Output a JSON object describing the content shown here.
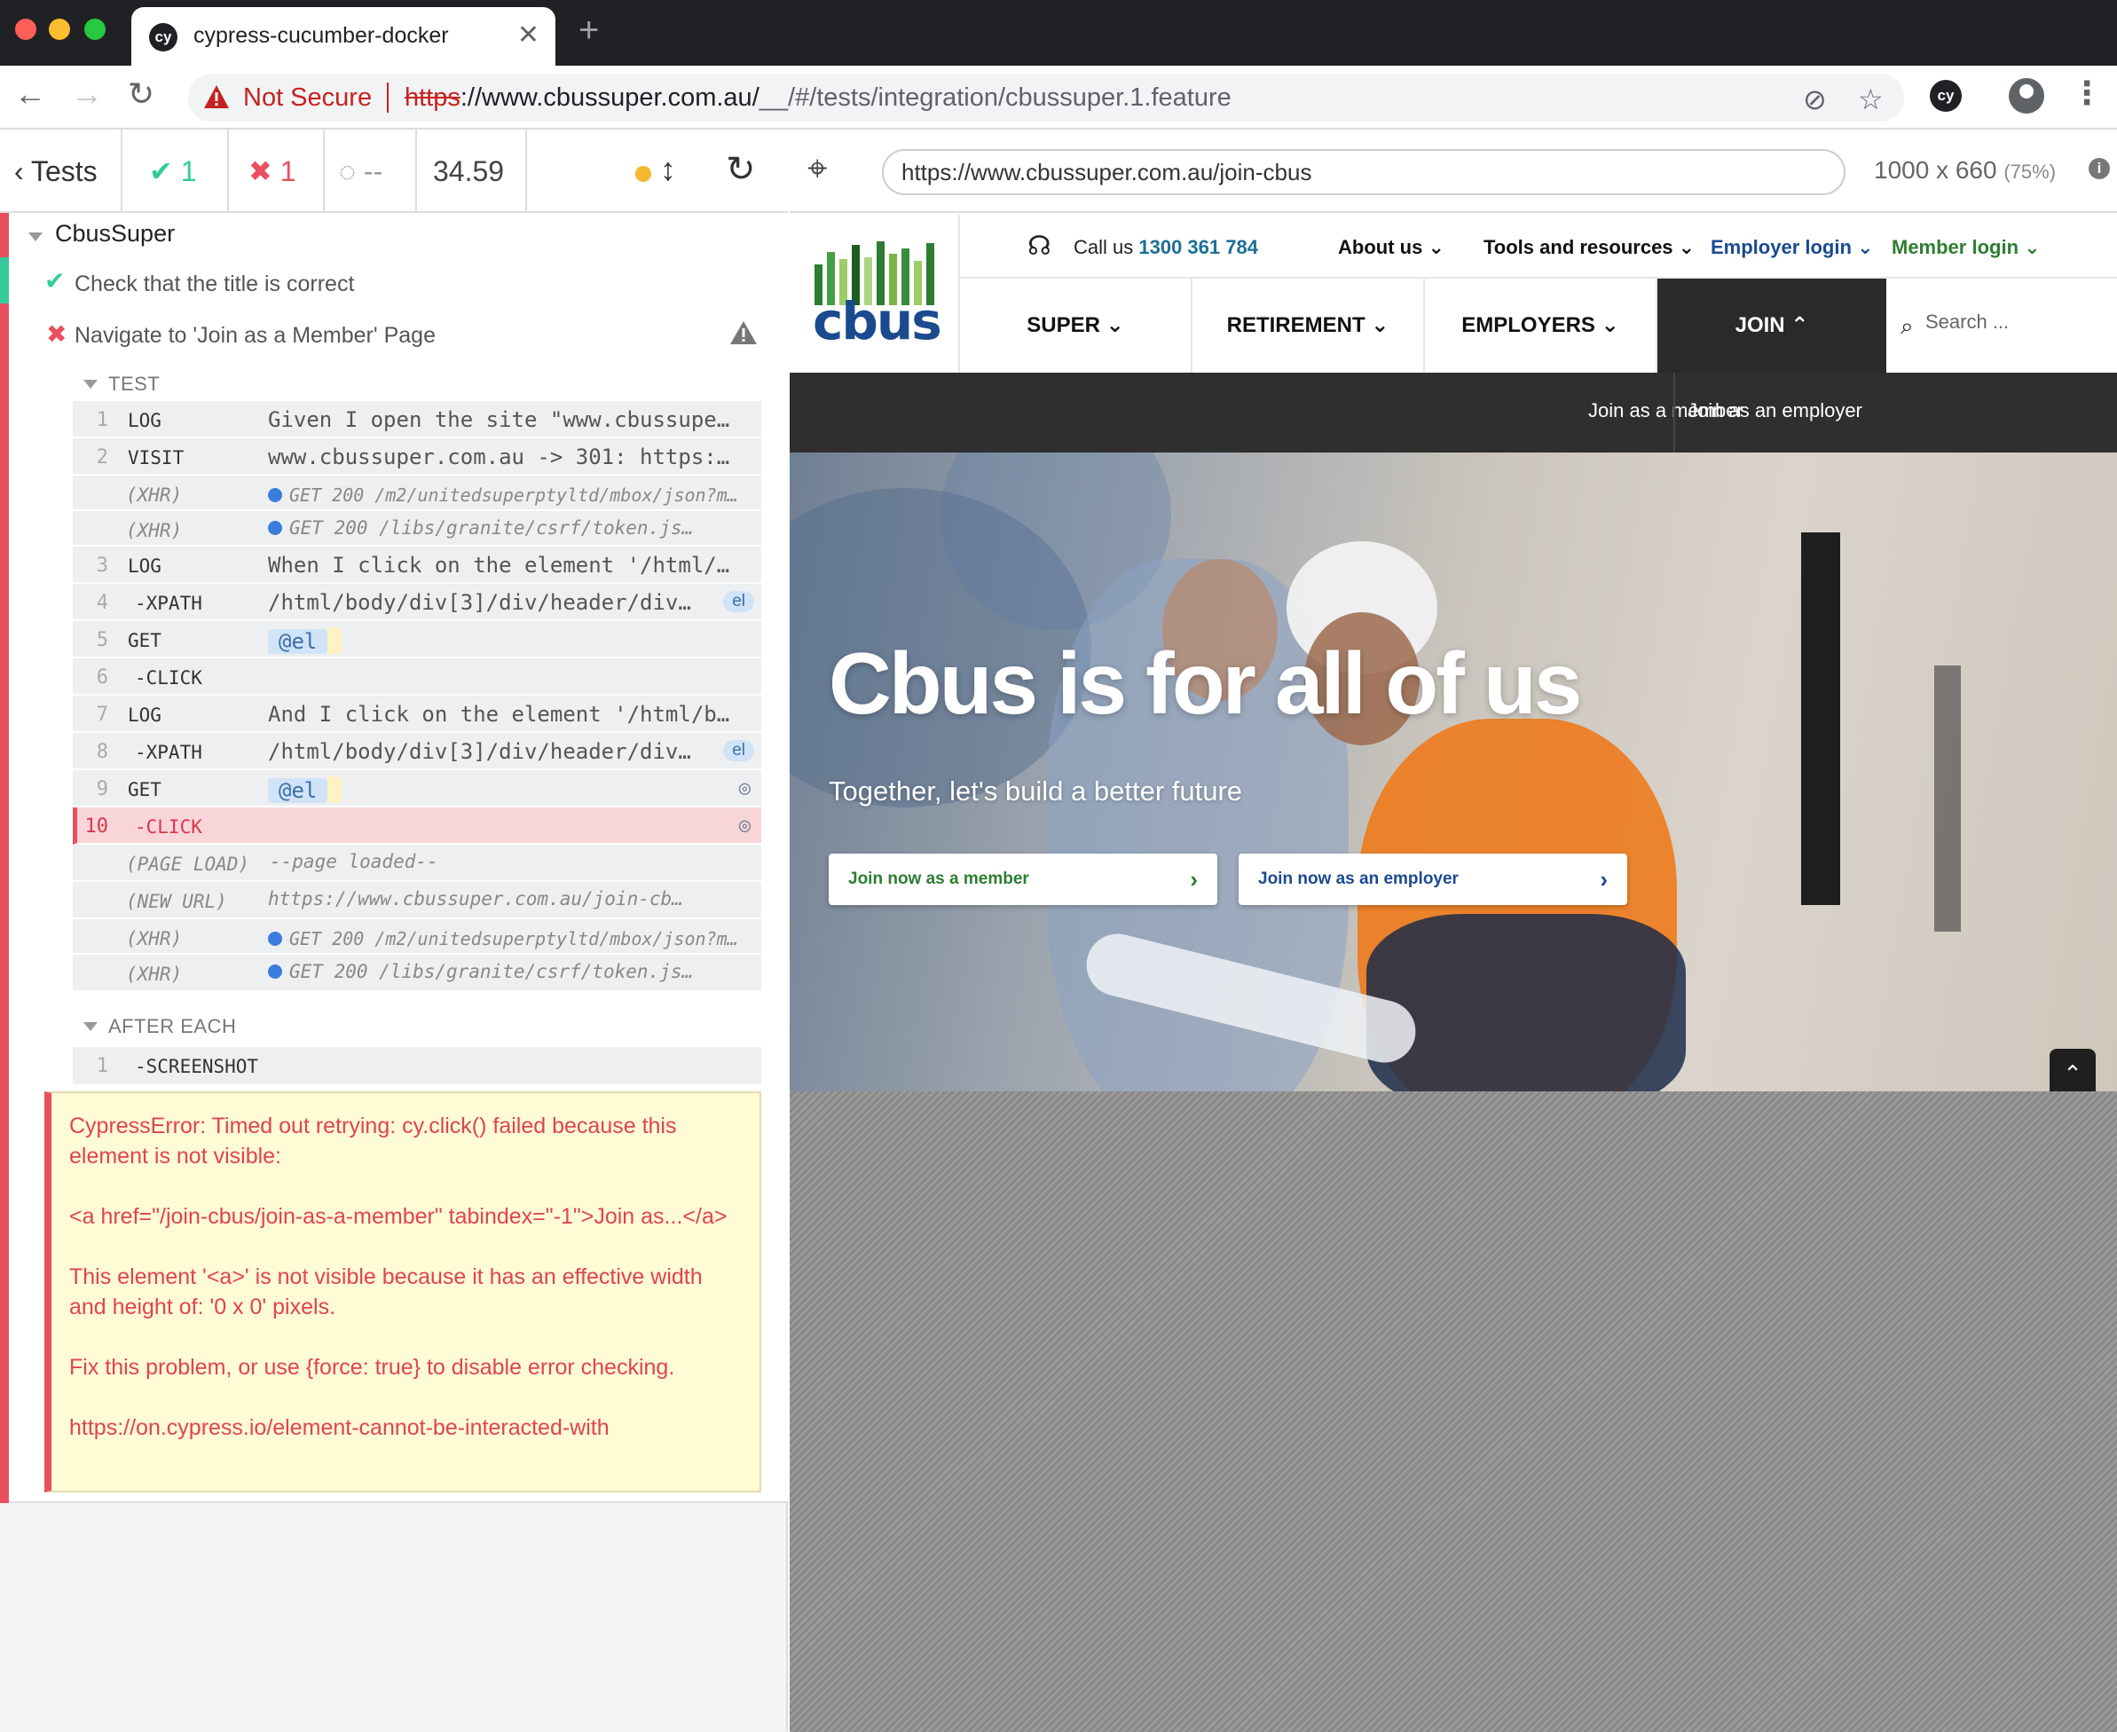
{
  "browser": {
    "tab_title": "cypress-cucumber-docker",
    "tab_close": "✕",
    "new_tab": "+",
    "not_secure": "Not Secure",
    "url_scheme": "https",
    "url_host": "://www.cbussuper.com.au/",
    "url_path": "__/#/tests/integration/cbussuper.1.feature",
    "extension_label": "cy",
    "favicon_label": "cy"
  },
  "reporter": {
    "tests_label": "Tests",
    "passed_count": "1",
    "failed_count": "1",
    "pending_count": "--",
    "duration": "34.59",
    "suite_title": "CbusSuper",
    "tests": [
      {
        "title": "Check that the title is correct",
        "state": "passed"
      },
      {
        "title": "Navigate to 'Join as a Member' Page",
        "state": "failed"
      }
    ],
    "hooks": {
      "test_label": "TEST",
      "after_each_label": "AFTER EACH"
    },
    "commands": [
      {
        "num": "1",
        "name": "LOG",
        "msg": "Given I open the site \"www.cbussuper…"
      },
      {
        "num": "2",
        "name": "VISIT",
        "msg": "www.cbussuper.com.au -> 301: https:/…"
      },
      {
        "num": "",
        "name": "(XHR)",
        "msg": "GET 200 /m2/unitedsuperptyltd/mbox/json?m…"
      },
      {
        "num": "",
        "name": "(XHR)",
        "msg": "GET 200 /libs/granite/csrf/token.js…"
      },
      {
        "num": "3",
        "name": "LOG",
        "msg": "When I click on the element '/html/b…"
      },
      {
        "num": "4",
        "name": "-XPATH",
        "msg": "/html/body/div[3]/div/header/div[…",
        "badge": "el"
      },
      {
        "num": "5",
        "name": "GET",
        "msg": "@el"
      },
      {
        "num": "6",
        "name": "-CLICK",
        "msg": ""
      },
      {
        "num": "7",
        "name": "LOG",
        "msg": "And I click on the element '/html/bo…"
      },
      {
        "num": "8",
        "name": "-XPATH",
        "msg": "/html/body/div[3]/div/header/div[…",
        "badge": "el"
      },
      {
        "num": "9",
        "name": "GET",
        "msg": "@el"
      },
      {
        "num": "10",
        "name": "-CLICK",
        "msg": ""
      },
      {
        "num": "",
        "name": "(PAGE LOAD)",
        "msg": "--page loaded--"
      },
      {
        "num": "",
        "name": "(NEW URL)",
        "msg": "https://www.cbussuper.com.au/join-cb…"
      },
      {
        "num": "",
        "name": "(XHR)",
        "msg": "GET 200 /m2/unitedsuperptyltd/mbox/json?m…"
      },
      {
        "num": "",
        "name": "(XHR)",
        "msg": "GET 200 /libs/granite/csrf/token.js…"
      }
    ],
    "after_each_commands": [
      {
        "num": "1",
        "name": "-SCREENSHOT"
      }
    ],
    "error": {
      "p1": "CypressError: Timed out retrying: cy.click() failed because this element is not visible:",
      "p2": "<a href=\"/join-cbus/join-as-a-member\" tabindex=\"-1\">Join as...</a>",
      "p3": "This element '<a>' is not visible because it has an effective width and height of: '0 x 0' pixels.",
      "p4": "Fix this problem, or use {force: true} to disable error checking.",
      "p5": "https://on.cypress.io/element-cannot-be-interacted-with"
    }
  },
  "aut": {
    "url": "https://www.cbussuper.com.au/join-cbus",
    "viewport": "1000 x 660",
    "scale": "(75%)"
  },
  "site": {
    "logo_text": "cbus",
    "call_label": "Call us ",
    "call_number": "1300 361 784",
    "util_links": [
      "About us",
      "Tools and resources",
      "Employer login",
      "Member login"
    ],
    "nav": [
      "SUPER",
      "RETIREMENT",
      "EMPLOYERS",
      "JOIN"
    ],
    "search_placeholder": "Search ...",
    "subnav": [
      "Join as a member",
      "Join as an employer"
    ],
    "hero_title": "Cbus is for all of us",
    "hero_subtitle": "Together, let's build a better future",
    "btn_member": "Join now as a member",
    "btn_employer": "Join now as an employer",
    "colors": {
      "brand_blue": "#1b4a8f",
      "brand_green": "#2e7d32",
      "cypress_red": "#e94f5f",
      "cypress_green": "#33cc99"
    }
  }
}
